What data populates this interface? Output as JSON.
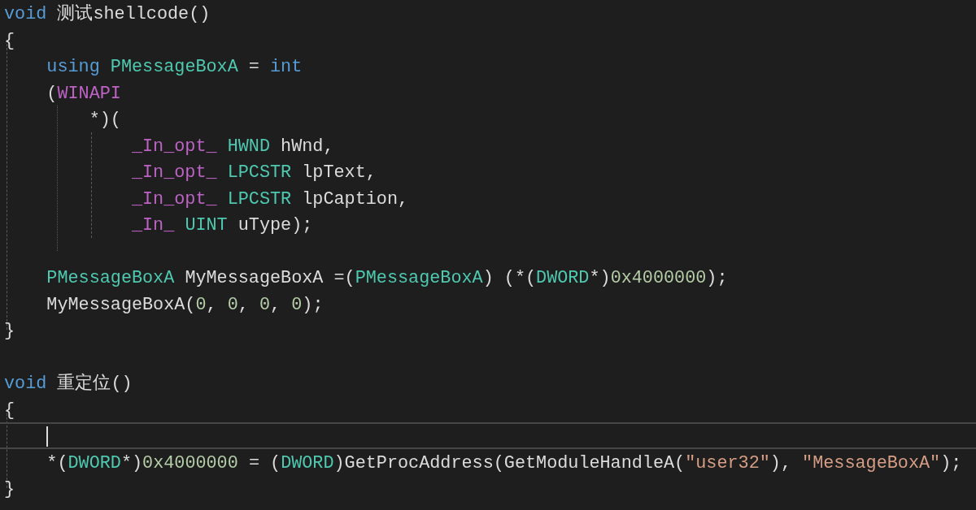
{
  "editor": {
    "lines": [
      {
        "current": false,
        "tokens": [
          {
            "text": "void",
            "kind": "keyword"
          },
          {
            "text": " 测试shellcode()",
            "kind": "plain"
          }
        ]
      },
      {
        "current": false,
        "tokens": [
          {
            "text": "{",
            "kind": "plain"
          }
        ]
      },
      {
        "current": false,
        "tokens": [
          {
            "text": "    using",
            "kind": "keyword"
          },
          {
            "text": " PMessageBoxA",
            "kind": "type"
          },
          {
            "text": " = ",
            "kind": "plain"
          },
          {
            "text": "int",
            "kind": "keyword"
          }
        ]
      },
      {
        "current": false,
        "tokens": [
          {
            "text": "    (",
            "kind": "plain"
          },
          {
            "text": "WINAPI",
            "kind": "macro"
          }
        ]
      },
      {
        "current": false,
        "tokens": [
          {
            "text": "        *)(",
            "kind": "plain"
          }
        ]
      },
      {
        "current": false,
        "tokens": [
          {
            "text": "            _In_opt_",
            "kind": "macro"
          },
          {
            "text": " HWND",
            "kind": "type"
          },
          {
            "text": " hWnd,",
            "kind": "plain"
          }
        ]
      },
      {
        "current": false,
        "tokens": [
          {
            "text": "            _In_opt_",
            "kind": "macro"
          },
          {
            "text": " LPCSTR",
            "kind": "type"
          },
          {
            "text": " lpText,",
            "kind": "plain"
          }
        ]
      },
      {
        "current": false,
        "tokens": [
          {
            "text": "            _In_opt_",
            "kind": "macro"
          },
          {
            "text": " LPCSTR",
            "kind": "type"
          },
          {
            "text": " lpCaption,",
            "kind": "plain"
          }
        ]
      },
      {
        "current": false,
        "tokens": [
          {
            "text": "            _In_",
            "kind": "macro"
          },
          {
            "text": " UINT",
            "kind": "type"
          },
          {
            "text": " uType);",
            "kind": "plain"
          }
        ]
      },
      {
        "current": false
      },
      {
        "current": false,
        "tokens": [
          {
            "text": "    PMessageBoxA",
            "kind": "type"
          },
          {
            "text": " MyMessageBoxA =(",
            "kind": "plain"
          },
          {
            "text": "PMessageBoxA",
            "kind": "type"
          },
          {
            "text": ") (*(",
            "kind": "plain"
          },
          {
            "text": "DWORD",
            "kind": "type"
          },
          {
            "text": "*)",
            "kind": "plain"
          },
          {
            "text": "0x4000000",
            "kind": "number"
          },
          {
            "text": ");",
            "kind": "plain"
          }
        ]
      },
      {
        "current": false,
        "tokens": [
          {
            "text": "    MyMessageBoxA(",
            "kind": "plain"
          },
          {
            "text": "0",
            "kind": "number"
          },
          {
            "text": ", ",
            "kind": "plain"
          },
          {
            "text": "0",
            "kind": "number"
          },
          {
            "text": ", ",
            "kind": "plain"
          },
          {
            "text": "0",
            "kind": "number"
          },
          {
            "text": ", ",
            "kind": "plain"
          },
          {
            "text": "0",
            "kind": "number"
          },
          {
            "text": ");",
            "kind": "plain"
          }
        ]
      },
      {
        "current": false,
        "tokens": [
          {
            "text": "}",
            "kind": "plain"
          }
        ]
      },
      {
        "current": false
      },
      {
        "current": false,
        "tokens": [
          {
            "text": "void",
            "kind": "keyword"
          },
          {
            "text": " 重定位()",
            "kind": "plain"
          }
        ]
      },
      {
        "current": false,
        "tokens": [
          {
            "text": "{",
            "kind": "plain"
          }
        ]
      },
      {
        "current": true
      },
      {
        "current": false,
        "tokens": [
          {
            "text": "    *(",
            "kind": "plain"
          },
          {
            "text": "DWORD",
            "kind": "type"
          },
          {
            "text": "*)",
            "kind": "plain"
          },
          {
            "text": "0x4000000",
            "kind": "number"
          },
          {
            "text": " = (",
            "kind": "plain"
          },
          {
            "text": "DWORD",
            "kind": "type"
          },
          {
            "text": ")GetProcAddress(GetModuleHandleA(",
            "kind": "plain"
          },
          {
            "text": "\"user32\"",
            "kind": "string"
          },
          {
            "text": "), ",
            "kind": "plain"
          },
          {
            "text": "\"MessageBoxA\"",
            "kind": "string"
          },
          {
            "text": ");",
            "kind": "plain"
          }
        ]
      },
      {
        "current": false,
        "tokens": [
          {
            "text": "}",
            "kind": "plain"
          }
        ]
      }
    ]
  }
}
